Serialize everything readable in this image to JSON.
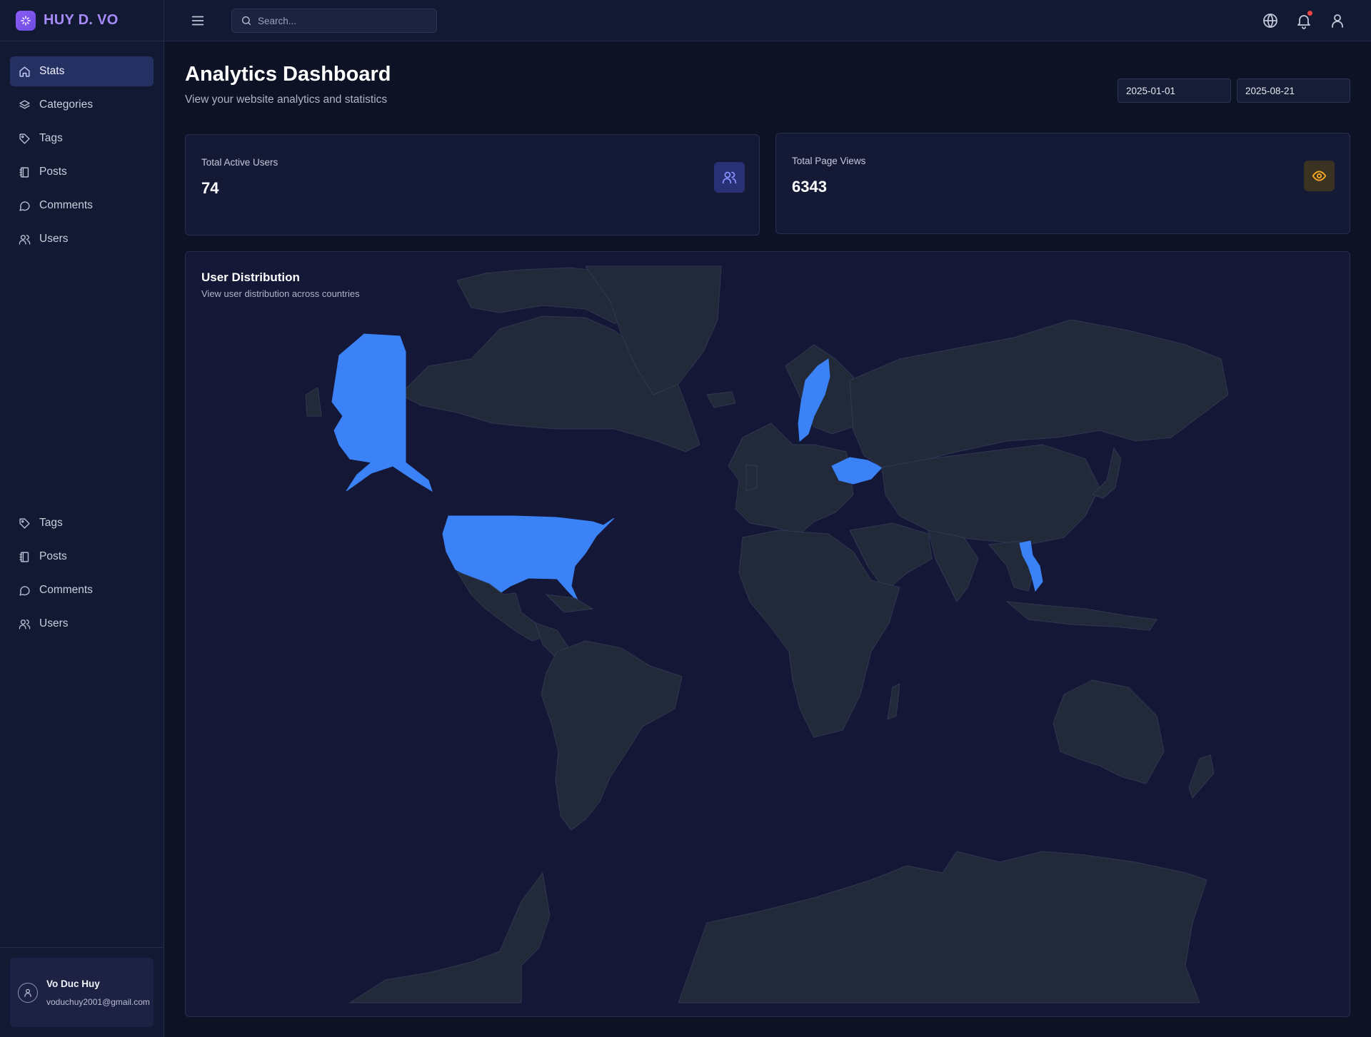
{
  "brand": {
    "name": "HUY D. VO"
  },
  "sidebar": {
    "top_items": [
      {
        "label": "Stats",
        "icon": "home-icon",
        "active": true
      },
      {
        "label": "Categories",
        "icon": "layers-icon"
      },
      {
        "label": "Tags",
        "icon": "tag-icon"
      },
      {
        "label": "Posts",
        "icon": "notebook-icon"
      },
      {
        "label": "Comments",
        "icon": "message-icon"
      },
      {
        "label": "Users",
        "icon": "users-icon"
      }
    ],
    "bottom_items": [
      {
        "label": "Tags",
        "icon": "tag-icon"
      },
      {
        "label": "Posts",
        "icon": "notebook-icon"
      },
      {
        "label": "Comments",
        "icon": "message-icon"
      },
      {
        "label": "Users",
        "icon": "users-icon"
      }
    ],
    "user": {
      "name": "Vo Duc Huy",
      "email": "voduchuy2001@gmail.com"
    }
  },
  "topbar": {
    "search_placeholder": "Search...",
    "icons": [
      "menu-icon",
      "search-icon",
      "globe-icon",
      "bell-icon",
      "user-icon"
    ],
    "has_notification": true
  },
  "header": {
    "title": "Analytics Dashboard",
    "subtitle": "View your website analytics and statistics",
    "date_from": "2025-01-01",
    "date_to": "2025-08-21"
  },
  "stats": [
    {
      "label": "Total Active Users",
      "value": "74",
      "icon": "users-icon",
      "accent": "#8b93ff"
    },
    {
      "label": "Total Page Views",
      "value": "6343",
      "icon": "eye-icon",
      "accent": "#f5a524"
    }
  ],
  "map": {
    "title": "User Distribution",
    "subtitle": "View user distribution across countries",
    "highlighted_countries": [
      "United States",
      "Sweden",
      "Ukraine",
      "Vietnam"
    ],
    "highlight_color": "#3b82f6",
    "land_color": "#222a3a"
  }
}
